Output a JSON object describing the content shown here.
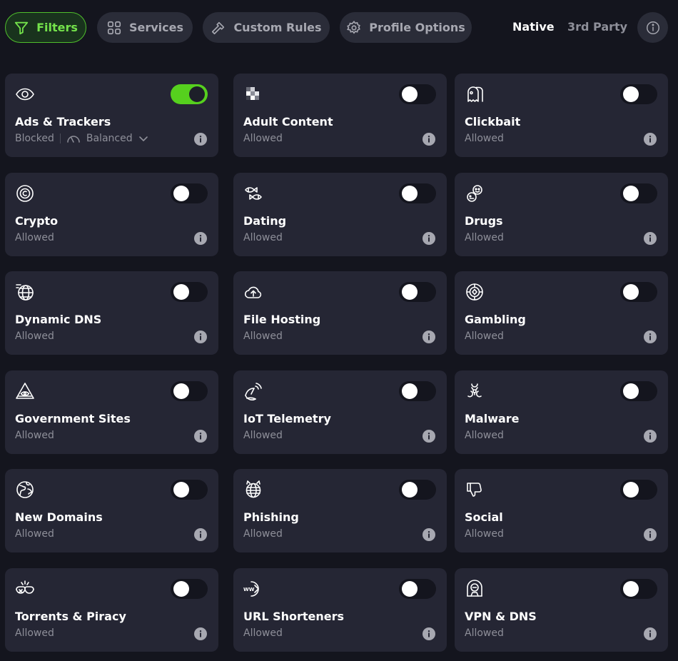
{
  "tabs": {
    "filters": "Filters",
    "services": "Services",
    "custom_rules": "Custom Rules",
    "profile_options": "Profile Options"
  },
  "source_toggle": {
    "native": "Native",
    "third_party": "3rd Party",
    "selected": "Native"
  },
  "colors": {
    "accent": "#56d01e",
    "card_bg": "#252634",
    "page_bg": "#14151e",
    "muted_text": "#8e8f99"
  },
  "filters": [
    {
      "title": "Ads & Trackers",
      "icon": "eye-icon",
      "status": "Blocked",
      "level": "Balanced",
      "enabled": true
    },
    {
      "title": "Adult Content",
      "icon": "pixelated-icon",
      "status": "Allowed",
      "enabled": false
    },
    {
      "title": "Clickbait",
      "icon": "ghost-icon",
      "status": "Allowed",
      "enabled": false
    },
    {
      "title": "Crypto",
      "icon": "coin-icon",
      "status": "Allowed",
      "enabled": false
    },
    {
      "title": "Dating",
      "icon": "fish-icon",
      "status": "Allowed",
      "enabled": false
    },
    {
      "title": "Drugs",
      "icon": "pills-icon",
      "status": "Allowed",
      "enabled": false
    },
    {
      "title": "Dynamic DNS",
      "icon": "globe-fast-icon",
      "status": "Allowed",
      "enabled": false
    },
    {
      "title": "File Hosting",
      "icon": "cloud-upload-icon",
      "status": "Allowed",
      "enabled": false
    },
    {
      "title": "Gambling",
      "icon": "casino-chip-icon",
      "status": "Allowed",
      "enabled": false
    },
    {
      "title": "Government Sites",
      "icon": "pyramid-eye-icon",
      "status": "Allowed",
      "enabled": false
    },
    {
      "title": "IoT Telemetry",
      "icon": "satellite-icon",
      "status": "Allowed",
      "enabled": false
    },
    {
      "title": "Malware",
      "icon": "biohazard-icon",
      "status": "Allowed",
      "enabled": false
    },
    {
      "title": "New Domains",
      "icon": "globe-leaf-icon",
      "status": "Allowed",
      "enabled": false
    },
    {
      "title": "Phishing",
      "icon": "devil-globe-icon",
      "status": "Allowed",
      "enabled": false
    },
    {
      "title": "Social",
      "icon": "thumbs-down-icon",
      "status": "Allowed",
      "enabled": false
    },
    {
      "title": "Torrents & Piracy",
      "icon": "eyepatch-icon",
      "status": "Allowed",
      "enabled": false
    },
    {
      "title": "URL Shorteners",
      "icon": "www-arrow-icon",
      "status": "Allowed",
      "enabled": false
    },
    {
      "title": "VPN & DNS",
      "icon": "vpn-shield-icon",
      "status": "Allowed",
      "enabled": false
    }
  ]
}
